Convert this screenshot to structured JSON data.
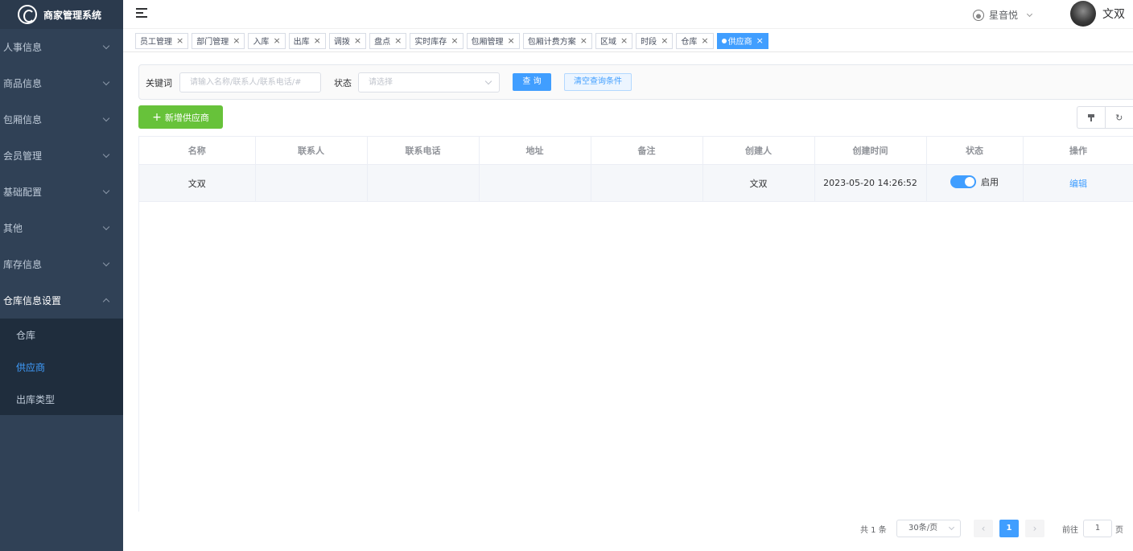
{
  "app": {
    "title": "商家管理系统"
  },
  "sidebar": {
    "items": [
      {
        "label": "人事信息"
      },
      {
        "label": "商品信息"
      },
      {
        "label": "包厢信息"
      },
      {
        "label": "会员管理"
      },
      {
        "label": "基础配置"
      },
      {
        "label": "其他"
      },
      {
        "label": "库存信息"
      },
      {
        "label": "仓库信息设置"
      }
    ],
    "submenu": [
      {
        "label": "仓库"
      },
      {
        "label": "供应商"
      },
      {
        "label": "出库类型"
      }
    ]
  },
  "header": {
    "shop": "星音悦",
    "user": "文双"
  },
  "tags": [
    {
      "label": "员工管理"
    },
    {
      "label": "部门管理"
    },
    {
      "label": "入库"
    },
    {
      "label": "出库"
    },
    {
      "label": "调拨"
    },
    {
      "label": "盘点"
    },
    {
      "label": "实时库存"
    },
    {
      "label": "包厢管理"
    },
    {
      "label": "包厢计费方案"
    },
    {
      "label": "区域"
    },
    {
      "label": "时段"
    },
    {
      "label": "仓库"
    },
    {
      "label": "供应商"
    }
  ],
  "search": {
    "keyword_label": "关键词",
    "keyword_placeholder": "请输入名称/联系人/联系电话/#",
    "status_label": "状态",
    "status_placeholder": "请选择",
    "query_button": "查 询",
    "clear_button": "清空查询条件"
  },
  "actions": {
    "add_button": "新增供应商"
  },
  "table": {
    "columns": [
      "名称",
      "联系人",
      "联系电话",
      "地址",
      "备注",
      "创建人",
      "创建时间",
      "状态",
      "操作"
    ],
    "rows": [
      {
        "name": "文双",
        "contact": "",
        "phone": "",
        "address": "",
        "remark": "",
        "creator": "文双",
        "created": "2023-05-20 14:26:52",
        "status": "启用",
        "op": "编辑"
      }
    ]
  },
  "pagination": {
    "total": "共 1 条",
    "page_size": "30条/页",
    "current": "1",
    "goto_label": "前往",
    "goto_value": "1",
    "page_suffix": "页"
  },
  "colors": {
    "sidebar": "#304156",
    "primary": "#409eff",
    "success": "#67c23a"
  }
}
